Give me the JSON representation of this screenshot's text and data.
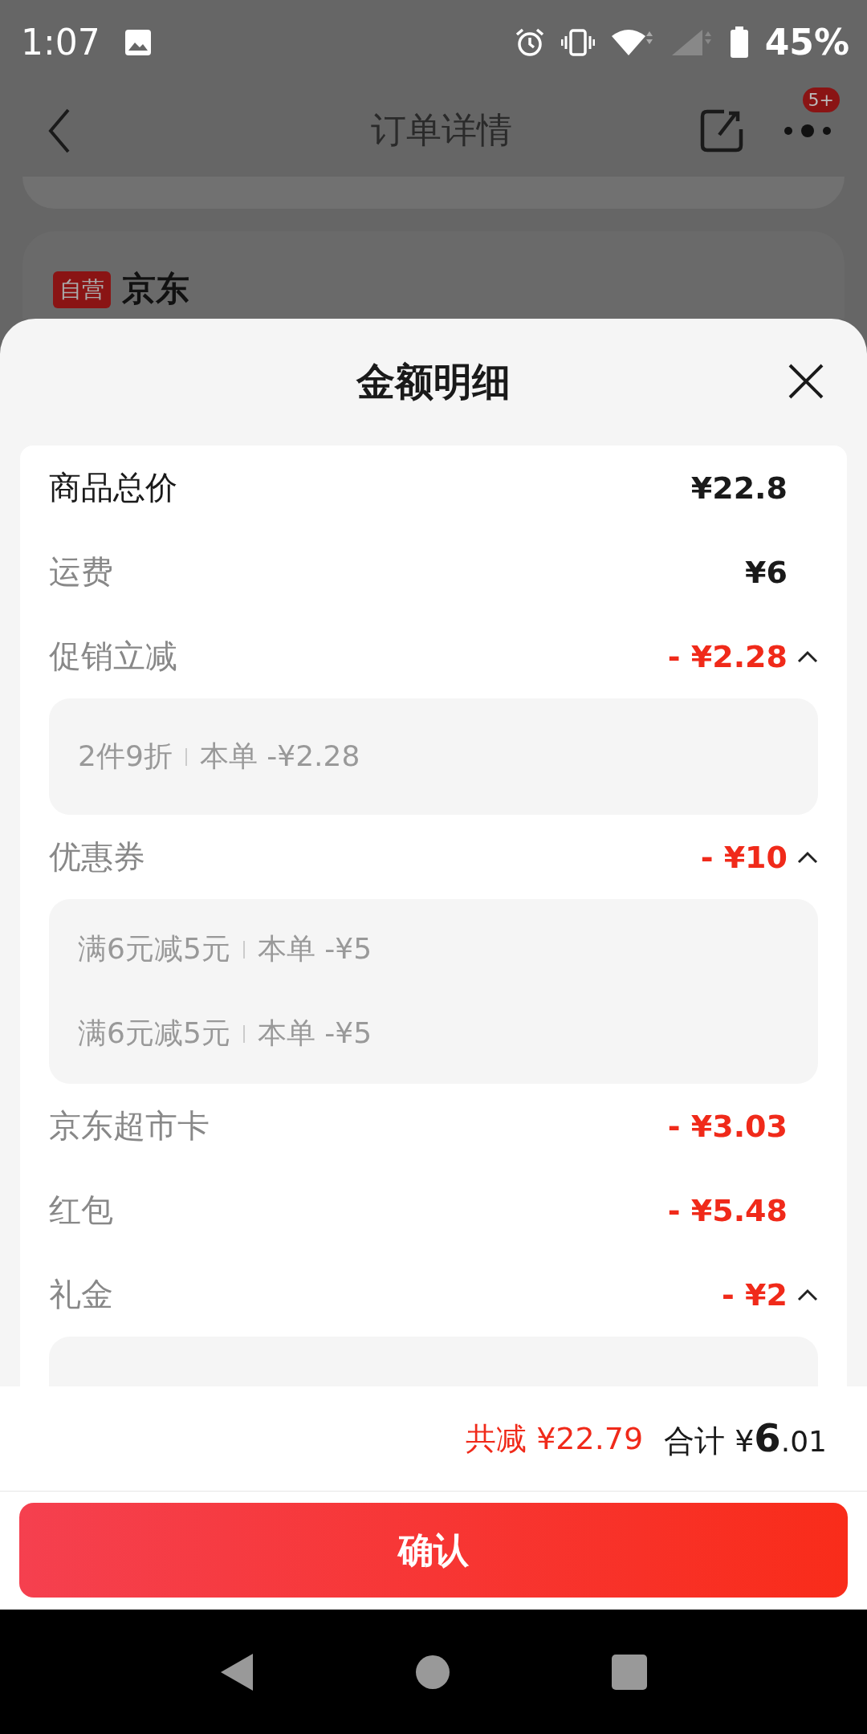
{
  "status_bar": {
    "time": "1:07",
    "battery": "45%"
  },
  "nav": {
    "title": "订单详情",
    "badge": "5+"
  },
  "store": {
    "tag": "自营",
    "name": "京东"
  },
  "sheet": {
    "title": "金额明细",
    "rows": [
      {
        "kind": "total",
        "label": "商品总价",
        "amount": "¥22.8"
      },
      {
        "kind": "fee",
        "label": "运费",
        "amount": "¥6"
      },
      {
        "kind": "discount",
        "label": "促销立减",
        "amount": "- ¥2.28",
        "expanded": true,
        "details": [
          {
            "name": "2件9折",
            "amount": "本单 -¥2.28"
          }
        ]
      },
      {
        "kind": "discount",
        "label": "优惠券",
        "amount": "- ¥10",
        "expanded": true,
        "details": [
          {
            "name": "满6元减5元",
            "amount": "本单 -¥5"
          },
          {
            "name": "满6元减5元",
            "amount": "本单 -¥5"
          }
        ]
      },
      {
        "kind": "discount",
        "label": "京东超市卡",
        "amount": "- ¥3.03"
      },
      {
        "kind": "discount",
        "label": "红包",
        "amount": "- ¥5.48"
      },
      {
        "kind": "discount",
        "label": "礼金",
        "amount": "- ¥2",
        "expanded": true
      }
    ],
    "summary": {
      "saved_label": "共减",
      "saved_amount": "¥22.79",
      "total_label": "合计",
      "currency": "¥",
      "total_int": "6",
      "total_dec": ".01"
    },
    "confirm": "确认"
  }
}
